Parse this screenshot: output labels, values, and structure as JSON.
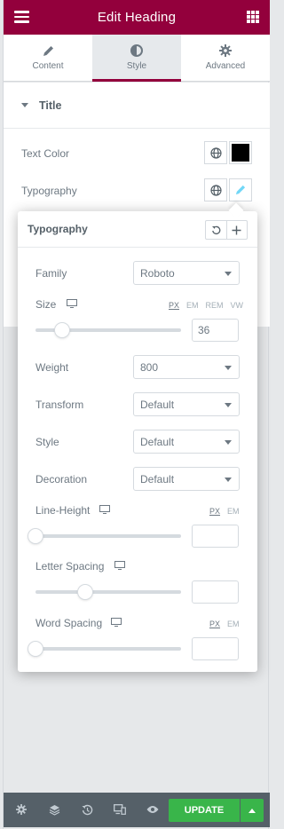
{
  "header": {
    "title": "Edit Heading"
  },
  "tabs": [
    {
      "label": "Content",
      "icon": "pencil-icon"
    },
    {
      "label": "Style",
      "icon": "contrast-icon"
    },
    {
      "label": "Advanced",
      "icon": "gear-icon"
    }
  ],
  "active_tab": "Style",
  "section": {
    "title": "Title"
  },
  "controls": {
    "text_color_label": "Text Color",
    "text_color_value": "#000000",
    "typography_label": "Typography"
  },
  "typography_popover": {
    "title": "Typography",
    "family": {
      "label": "Family",
      "value": "Roboto"
    },
    "size": {
      "label": "Size",
      "units": [
        "PX",
        "EM",
        "REM",
        "VW"
      ],
      "active_unit": "PX",
      "value": "36",
      "slider_fraction": 0.18
    },
    "weight": {
      "label": "Weight",
      "value": "800"
    },
    "transform": {
      "label": "Transform",
      "value": "Default"
    },
    "style": {
      "label": "Style",
      "value": "Default"
    },
    "decoration": {
      "label": "Decoration",
      "value": "Default"
    },
    "line_height": {
      "label": "Line-Height",
      "units": [
        "PX",
        "EM"
      ],
      "active_unit": "PX",
      "value": "",
      "slider_fraction": 0.0
    },
    "letter_spacing": {
      "label": "Letter Spacing",
      "value": "",
      "slider_fraction": 0.34
    },
    "word_spacing": {
      "label": "Word Spacing",
      "units": [
        "PX",
        "EM"
      ],
      "active_unit": "PX",
      "value": "",
      "slider_fraction": 0.0
    }
  },
  "footer": {
    "update_label": "UPDATE"
  },
  "colors": {
    "brand": "#93003c",
    "update": "#39b54a",
    "footer_bg": "#556068"
  }
}
